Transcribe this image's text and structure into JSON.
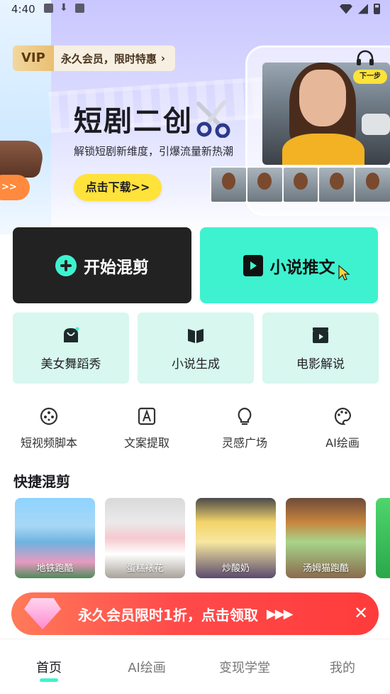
{
  "status_bar": {
    "time": "4:40"
  },
  "vip_banner": {
    "tag": "VIP",
    "text": "永久会员，限时特惠",
    "arrow": "›"
  },
  "hero": {
    "title": "短剧二创",
    "subtitle": "解锁短剧新维度，引爆流量新热潮",
    "download_button": "点击下载>>",
    "next_step": "下一步",
    "left_pill": ">>"
  },
  "main_actions": [
    {
      "label": "开始混剪",
      "icon": "plus-circle-icon"
    },
    {
      "label": "小说推文",
      "icon": "play-book-icon"
    }
  ],
  "feature_cards": [
    {
      "label": "美女舞蹈秀",
      "icon": "dance-icon"
    },
    {
      "label": "小说生成",
      "icon": "open-book-icon"
    },
    {
      "label": "电影解说",
      "icon": "clapperboard-icon"
    }
  ],
  "tools": [
    {
      "label": "短视频脚本",
      "icon": "film-reel-icon"
    },
    {
      "label": "文案提取",
      "icon": "letter-a-icon"
    },
    {
      "label": "灵感广场",
      "icon": "lightbulb-icon"
    },
    {
      "label": "AI绘画",
      "icon": "palette-icon"
    }
  ],
  "quick_mix": {
    "title": "快捷混剪",
    "items": [
      {
        "label": "地铁跑酷"
      },
      {
        "label": "蛋糕裱花"
      },
      {
        "label": "炒酸奶"
      },
      {
        "label": "汤姆猫跑酷"
      }
    ]
  },
  "promo": {
    "text": "永久会员限时1折，点击领取",
    "arrows": "▶▶▶",
    "close": "✕"
  },
  "tab_bar": {
    "tabs": [
      {
        "label": "首页",
        "active": true
      },
      {
        "label": "AI绘画",
        "active": false
      },
      {
        "label": "变现学堂",
        "active": false
      },
      {
        "label": "我的",
        "active": false
      }
    ]
  },
  "colors": {
    "accent": "#3ef2cf",
    "dark": "#222222",
    "promo": "#ff4a4a",
    "button_yellow": "#ffe23a"
  }
}
